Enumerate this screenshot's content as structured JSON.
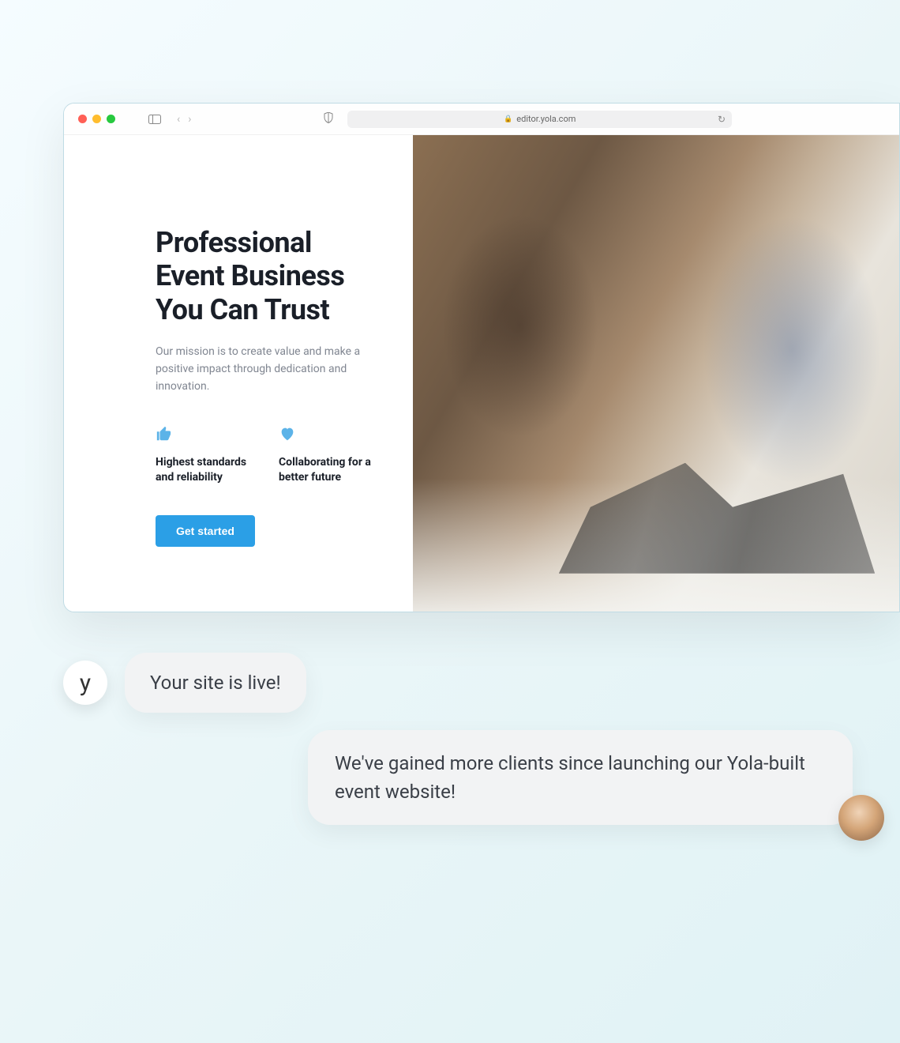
{
  "browser": {
    "url": "editor.yola.com"
  },
  "hero": {
    "title_l1": "Professional",
    "title_l2": "Event Business",
    "title_l3": "You Can Trust",
    "subtitle": "Our mission is to create value and make a positive impact through dedication and innovation."
  },
  "features": [
    {
      "icon": "thumbs-up-icon",
      "title": "Highest standards and reliability"
    },
    {
      "icon": "heart-icon",
      "title": "Collaborating for a better future"
    }
  ],
  "cta": {
    "label": "Get started"
  },
  "chat": {
    "assistant_avatar_glyph": "y",
    "messages": [
      {
        "from": "assistant",
        "text": "Your site is live!"
      },
      {
        "from": "user",
        "text": "We've gained more clients since launching our Yola-built event website!"
      }
    ]
  }
}
